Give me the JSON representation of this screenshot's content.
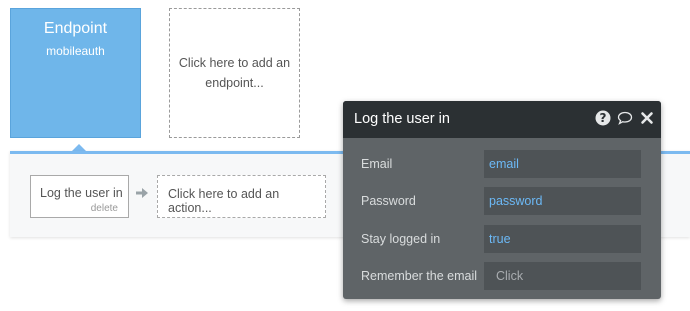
{
  "endpoint": {
    "title": "Endpoint",
    "name": "mobileauth"
  },
  "add_endpoint": {
    "label": "Click here to add an endpoint..."
  },
  "workflow": {
    "action": {
      "label": "Log the user in",
      "delete_label": "delete"
    },
    "add_action": {
      "label": "Click here to add an action..."
    }
  },
  "property_editor": {
    "title": "Log the user in",
    "icons": [
      "help-icon",
      "comment-icon",
      "close-icon"
    ],
    "fields": [
      {
        "label": "Email",
        "value": "email"
      },
      {
        "label": "Password",
        "value": "password"
      },
      {
        "label": "Stay logged in",
        "value": "true"
      },
      {
        "label": "Remember the email",
        "value": "Click"
      }
    ]
  },
  "colors": {
    "accent": "#6fb6ea",
    "panel_header": "#2b3033",
    "panel_body": "#5f6467",
    "field_value": "#6cb9f6"
  }
}
